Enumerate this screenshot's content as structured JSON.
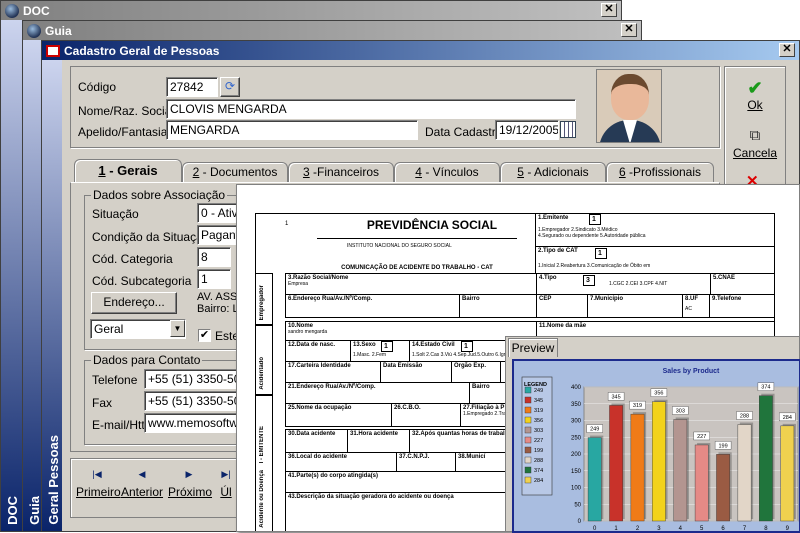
{
  "windows": {
    "doc_title": "DOC",
    "guia_title": "Guia",
    "main_title": "Cadastro Geral de Pessoas",
    "side_doc": "DOC",
    "side_guia": "Guia",
    "side_geral": "Geral Pessoas"
  },
  "form": {
    "codigo_label": "Código",
    "codigo_value": "27842",
    "nome_label": "Nome/Raz. Social",
    "nome_value": "CLOVIS MENGARDA",
    "apelido_label": "Apelido/Fantasia",
    "apelido_value": "MENGARDA",
    "data_label": "Data Cadastro",
    "data_value": "19/12/2005"
  },
  "actions": {
    "ok": "Ok",
    "cancel": "Cancela"
  },
  "tabs": [
    {
      "num": "1",
      "label": " - Gerais"
    },
    {
      "num": "2",
      "label": " - Documentos"
    },
    {
      "num": "3",
      "label": " -Financeiros"
    },
    {
      "num": "4",
      "label": " - Vínculos"
    },
    {
      "num": "5",
      "label": " - Adicionais"
    },
    {
      "num": "6",
      "label": " -Profissionais"
    }
  ],
  "assoc": {
    "group": "Dados sobre Associação",
    "situacao_label": "Situação",
    "situacao_value": "0 - Ativo",
    "condicao_label": "Condição da Situação",
    "condicao_value": "Pagante",
    "categoria_label": "Cód. Categoria",
    "categoria_value": "8",
    "subcategoria_label": "Cód. Subcategoria",
    "subcategoria_value": "1",
    "endereco_button": "Endereço...",
    "address_line1": "AV. ASS",
    "address_line2": "Bairro: L",
    "tipo_value": "Geral",
    "este_label": "Este"
  },
  "contato": {
    "group": "Dados para Contato",
    "telefone_label": "Telefone",
    "telefone_value": "+55 (51) 3350-5012",
    "fax_label": "Fax",
    "fax_value": "+55 (51) 3350-5032",
    "email_label": "E-mail/Http",
    "email_value": "www.memosoftware"
  },
  "nav": {
    "primeiro": "Primeiro",
    "anterior": "Anterior",
    "proximo": "Próximo",
    "ultimo": "Úl"
  },
  "doc": {
    "title": "PREVIDÊNCIA SOCIAL",
    "institute": "INSTITUTO NACIONAL DO SEGURO SOCIAL",
    "subtitle": "COMUNICAÇÃO DE ACIDENTE DO TRABALHO - CAT",
    "page_num": "1",
    "emitente": "1.Emitente",
    "emitente_val": "1",
    "emitente_opts1": "1.Empregador 2.Sindicato 3.Médico",
    "emitente_opts2": "4.Segurado ou dependente 5.Autoridade pública",
    "tipo_cat": "2.Tipo de CAT",
    "tipo_cat_val": "1",
    "tipo_cat_opts": "1.Inicial 2.Reabertura 3.Comunicação de Óbito em",
    "razao": "3.Razão Social/Nome",
    "razao_sub": "Empresa",
    "tipo": "4.Tipo",
    "tipo_val": "3",
    "tipo_opts": "1.CGC 2.CEI 3.CPF 4.NIT",
    "cnae": "5.CNAE",
    "endereco": "6.Endereço Rua/Av./Nº/Comp.",
    "bairro": "Bairro",
    "cep": "CEP",
    "municipio": "7.Município",
    "uf": "8.UF",
    "uf_val": "AC",
    "telefone": "9.Telefone",
    "nome": "10.Nome",
    "nome_sub": "sandro mengarda",
    "nome_mae": "11.Nome da mãe",
    "data_nasc": "12.Data de nasc.",
    "sexo": "13.Sexo",
    "sexo_val": "1",
    "sexo_opts": "1.Masc. 2.Fem",
    "estado_civil": "14.Estado Civil",
    "estado_civil_val": "1",
    "estado_civil_opts": "1.Solt 2.Cas 3.Viú 4.Sep.Jud.5.Outro 6.Ign",
    "ctps": "17.Carteira Identidade",
    "data_emissao": "Data Emissão",
    "orgao": "Órgão Exp.",
    "end_acid": "21.Endereço Rua/Av./Nº/Comp.",
    "bairro2": "Bairro",
    "ocupacao": "25.Nome da ocupação",
    "cbo": "26.C.B.O.",
    "filiacao": "27.Filiação à P",
    "filiacao_opts": "1.Empregado 2.Tra",
    "data_acidente": "30.Data acidente",
    "hora_acidente": "31.Hora acidente",
    "horas_trab": "32.Após quantas horas de trabal",
    "local": "36.Local do acidente",
    "cnpj": "37.C.N.P.J.",
    "municipio2": "38.Municí",
    "partes": "41.Parte(s) do corpo atingida(s)",
    "descricao": "43.Descrição da situação geradora do acidente ou doença",
    "side_empregador": "Empregador",
    "side_acidentado": "Acidentado",
    "side_emitente": "I - EMITENTE",
    "side_acidente": "Acidente ou Doença"
  },
  "preview": {
    "tab": "Preview"
  },
  "chart_data": {
    "type": "bar",
    "title": "Sales by Product",
    "legend_title": "LEGEND",
    "categories": [
      "0",
      "1",
      "2",
      "3",
      "4",
      "5",
      "6",
      "7",
      "8",
      "9"
    ],
    "values": [
      249,
      345,
      319,
      356,
      303,
      227,
      199,
      288,
      374,
      284
    ],
    "colors": [
      "#28a7a2",
      "#c8322a",
      "#ef7b18",
      "#f2d21b",
      "#b39590",
      "#e58a86",
      "#9a5b43",
      "#e2d6c8",
      "#20753c",
      "#efd14f"
    ],
    "ylim": [
      0,
      400
    ],
    "yticks": [
      0,
      50,
      100,
      150,
      200,
      250,
      300,
      350,
      400
    ]
  }
}
